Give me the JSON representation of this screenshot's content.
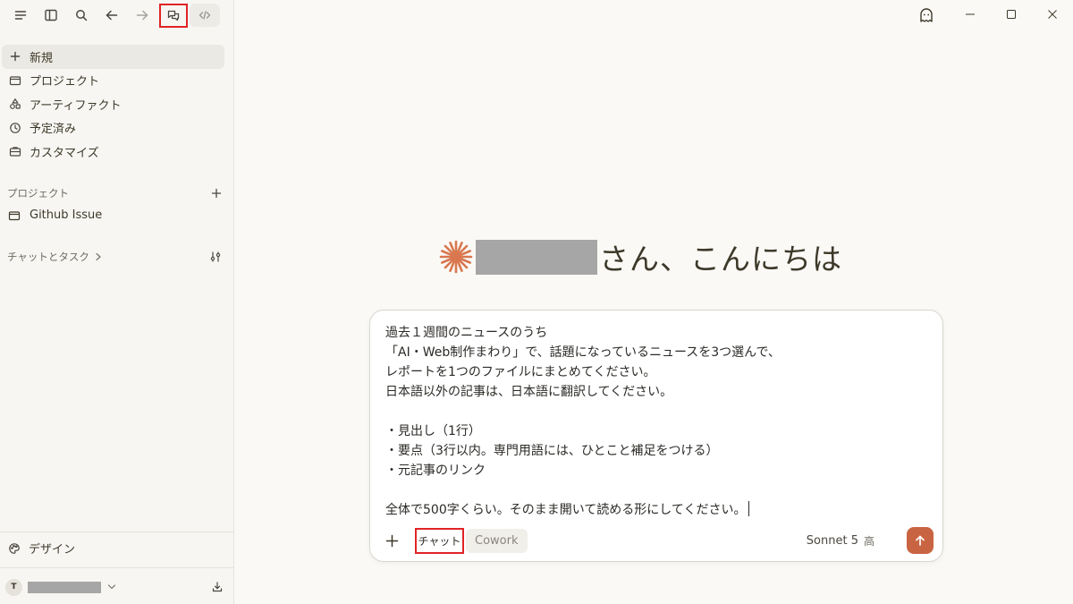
{
  "toolbar": {
    "icons": [
      "menu-icon",
      "sidebar-toggle-icon",
      "search-icon",
      "back-arrow-icon",
      "forward-arrow-icon",
      "chat-bubbles-icon",
      "code-icon"
    ]
  },
  "sidebar": {
    "nav": [
      {
        "label": "新規",
        "icon": "plus-icon"
      },
      {
        "label": "プロジェクト",
        "icon": "folder-icon"
      },
      {
        "label": "アーティファクト",
        "icon": "shapes-icon"
      },
      {
        "label": "予定済み",
        "icon": "clock-icon"
      },
      {
        "label": "カスタマイズ",
        "icon": "briefcase-icon"
      }
    ],
    "projects_heading": "プロジェクト",
    "project_items": [
      {
        "label": "Github Issue"
      }
    ],
    "chats_heading": "チャットとタスク",
    "design_label": "デザイン",
    "user_initial": "T"
  },
  "main": {
    "greeting_suffix": "さん、こんにちは",
    "prompt_lines": [
      "過去１週間のニュースのうち",
      "「AI・Web制作まわり」で、話題になっているニュースを3つ選んで、",
      "レポートを1つのファイルにまとめてください。",
      "日本語以外の記事は、日本語に翻訳してください。",
      "",
      "・見出し（1行）",
      "・要点（3行以内。専門用語には、ひとこと補足をつける）",
      "・元記事のリンク",
      "",
      "全体で500字くらい。そのまま開いて読める形にしてください。"
    ],
    "mode_chat": "チャット",
    "mode_cowork": "Cowork",
    "model": "Sonnet 5",
    "effort": "高"
  },
  "colors": {
    "accent": "#c96442",
    "highlight_box": "#e02424",
    "background": "#faf9f6"
  }
}
